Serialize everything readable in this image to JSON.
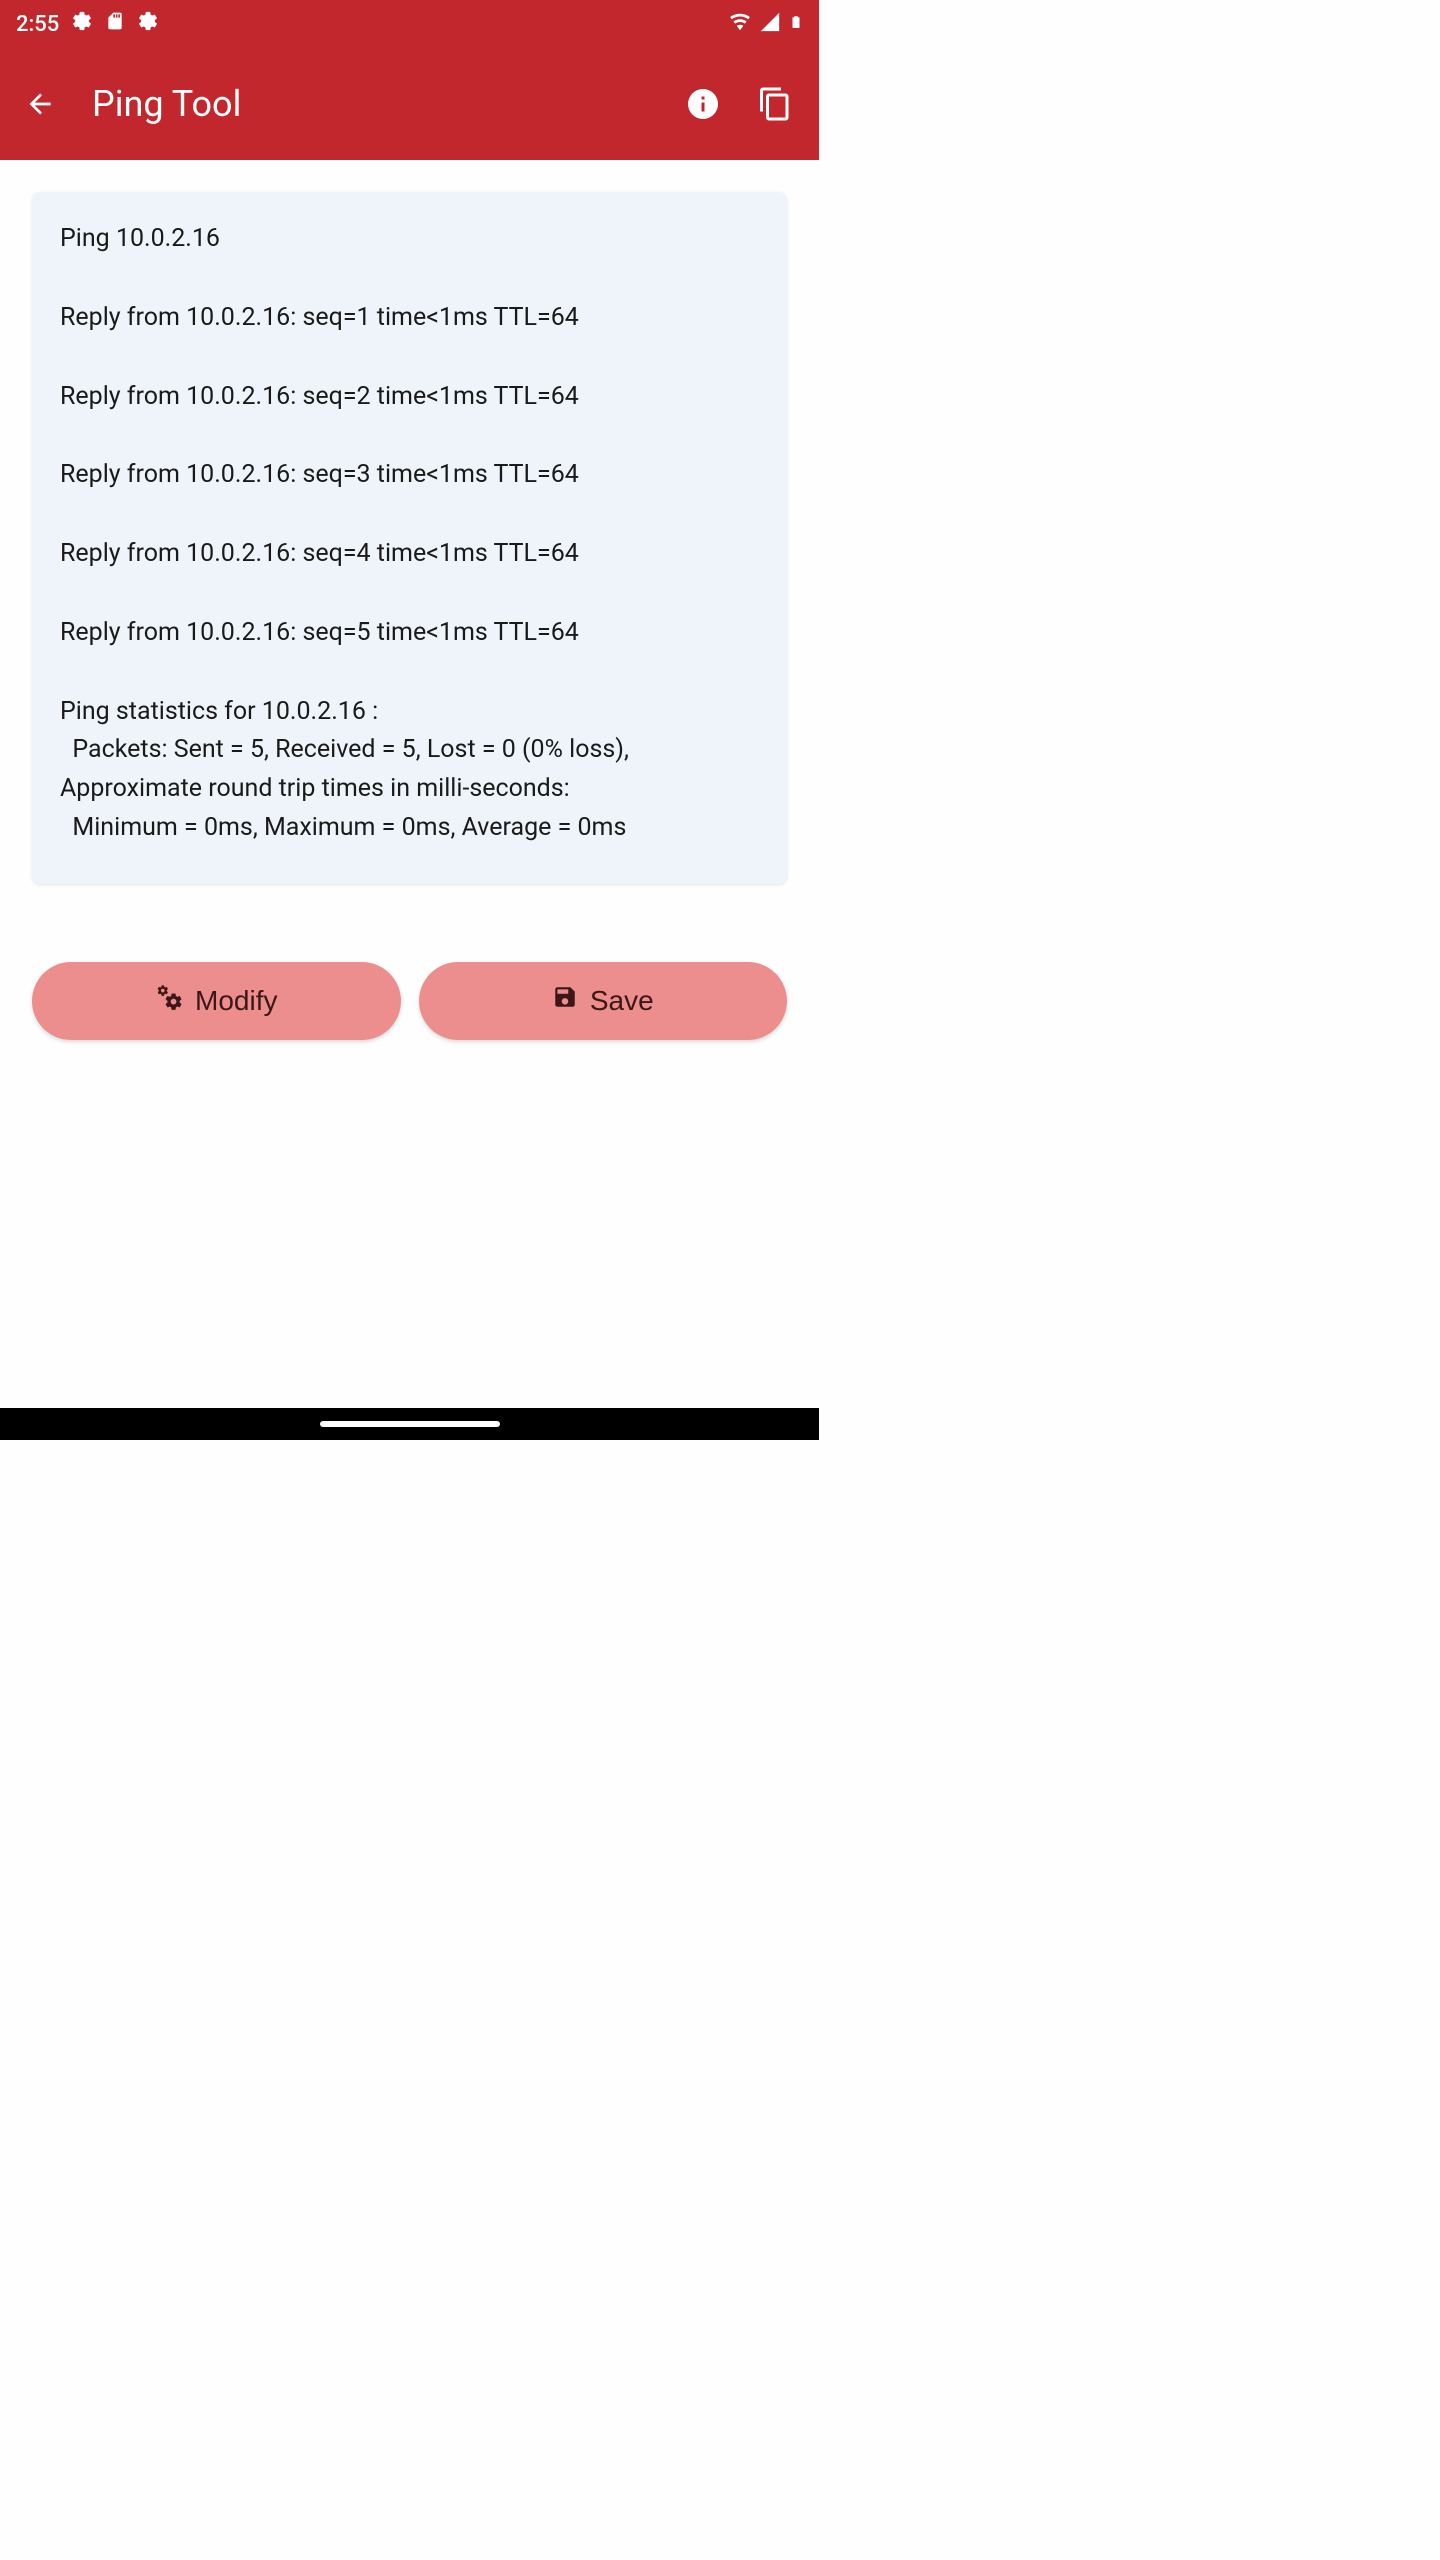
{
  "statusBar": {
    "time": "2:55"
  },
  "appBar": {
    "title": "Ping Tool"
  },
  "output": {
    "header": "Ping 10.0.2.16",
    "reply1": "Reply from 10.0.2.16: seq=1 time<1ms TTL=64",
    "reply2": "Reply from 10.0.2.16: seq=2 time<1ms TTL=64",
    "reply3": "Reply from 10.0.2.16: seq=3 time<1ms TTL=64",
    "reply4": "Reply from 10.0.2.16: seq=4 time<1ms TTL=64",
    "reply5": "Reply from 10.0.2.16: seq=5 time<1ms TTL=64",
    "statsHeader": "Ping statistics for 10.0.2.16 :",
    "statsPackets": "  Packets: Sent = 5, Received = 5, Lost = 0 (0% loss),",
    "statsRtt": "Approximate round trip times in milli-seconds:",
    "statsTimes": "  Minimum = 0ms, Maximum = 0ms, Average = 0ms"
  },
  "buttons": {
    "modify": "Modify",
    "save": "Save"
  }
}
